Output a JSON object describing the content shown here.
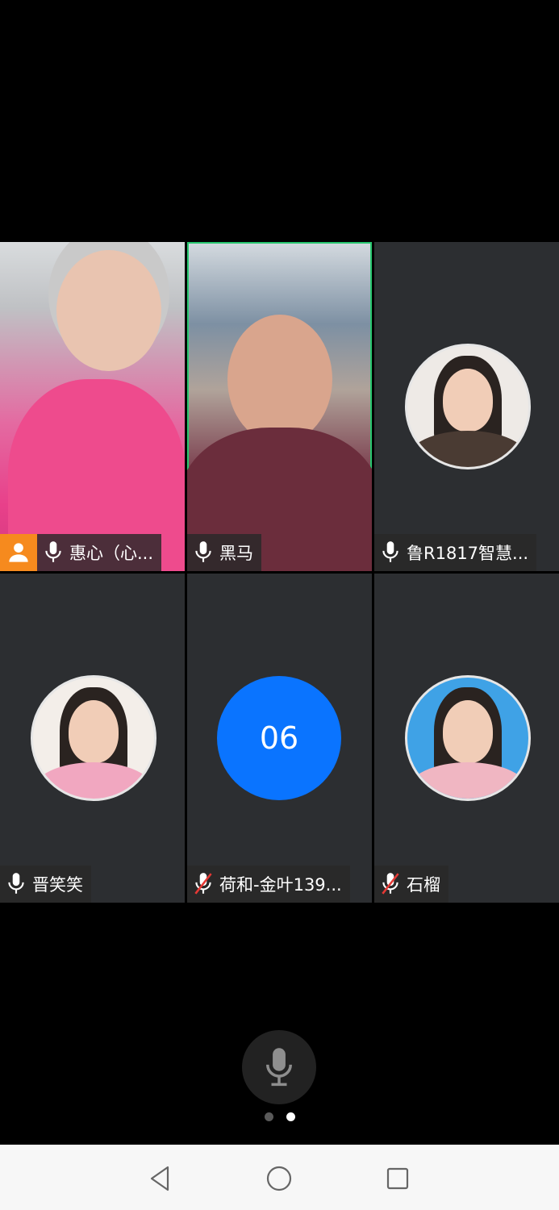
{
  "participants": [
    {
      "name": "惠心（心...",
      "host": true,
      "muted": false,
      "type": "video"
    },
    {
      "name": "黑马",
      "host": false,
      "muted": false,
      "type": "video",
      "active": true
    },
    {
      "name": "鲁R1817智慧...",
      "host": false,
      "muted": false,
      "type": "avatar"
    },
    {
      "name": "晋笑笑",
      "host": false,
      "muted": false,
      "type": "avatar"
    },
    {
      "name": "荷和-金叶139...",
      "host": false,
      "muted": true,
      "type": "number",
      "avatar_text": "06"
    },
    {
      "name": "石榴",
      "host": false,
      "muted": true,
      "type": "avatar"
    }
  ],
  "pagination": {
    "total": 2,
    "current": 2
  },
  "colors": {
    "active_border": "#28c76f",
    "host_badge": "#f68a1e",
    "number_avatar": "#0a74ff",
    "tile_bg": "#2c2e31",
    "muted_slash": "#e53935"
  },
  "icons": {
    "mic": "microphone-icon",
    "mic_off": "microphone-off-icon",
    "host": "person-icon",
    "back": "triangle-back-icon",
    "home": "circle-home-icon",
    "recents": "square-recents-icon"
  }
}
